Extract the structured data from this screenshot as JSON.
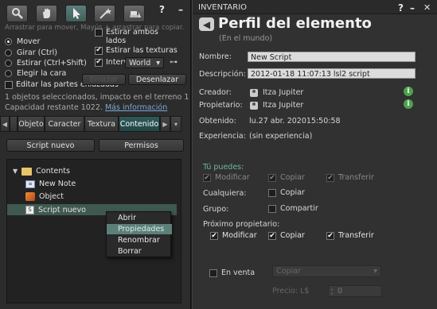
{
  "build": {
    "hint": "Arrastrar para mover, Mayús + arrastrar para copiar.",
    "modes": [
      {
        "label": "Mover",
        "selected": true
      },
      {
        "label": "Girar (Ctrl)",
        "selected": false
      },
      {
        "label": "Estirar (Ctrl+Shift)",
        "selected": false
      },
      {
        "label": "Elegir la cara",
        "selected": false
      }
    ],
    "stretch_both": "Estirar ambos lados",
    "stretch_textures": "Estirar las texturas",
    "snap_interval": "Interv",
    "grid_mode": "World",
    "edit_linked": "Editar las partes enlazadas",
    "link_button": "Enlazar",
    "unlink_button": "Desenlazar",
    "selection_info": "1 objetos seleccionados, impacto en el terreno 1",
    "capacity": "Capacidad restante 1022.",
    "more_info": "Más información",
    "tabs": [
      "Objeto",
      "Caracter",
      "Textura",
      "Contenido"
    ],
    "active_tab": "Contenido",
    "new_script_button": "Script nuevo",
    "permissions_button": "Permisos",
    "tree": {
      "folder": "Contents",
      "items": [
        "New Note",
        "Object",
        "Script nuevo"
      ]
    },
    "context_menu": [
      "Abrir",
      "Propiedades",
      "Renombrar",
      "Borrar"
    ],
    "context_highlight": "Propiedades"
  },
  "inventory": {
    "window_title": "INVENTARIO",
    "title": "Perfil del elemento",
    "subtitle": "(En el mundo)",
    "name_label": "Nombre:",
    "name_value": "New Script",
    "description_label": "Descripción:",
    "description_value": "2012-01-18 11:07:13 lsl2 script",
    "creator_label": "Creador:",
    "creator_value": "Itza Jupiter",
    "owner_label": "Propietario:",
    "owner_value": "Itza Jupiter",
    "acquired_label": "Obtenido:",
    "acquired_value": "lu.27 abr. 202015:50:58",
    "experience_label": "Experiencia:",
    "experience_value": "(sin experiencia)",
    "you_can_label": "Tú puedes:",
    "you_can": [
      {
        "label": "Modificar",
        "checked": true
      },
      {
        "label": "Copiar",
        "checked": true
      },
      {
        "label": "Transferir",
        "checked": true
      }
    ],
    "anyone_label": "Cualquiera:",
    "anyone_copy": "Copiar",
    "group_label": "Grupo:",
    "group_share": "Compartir",
    "next_owner_label": "Próximo propietario:",
    "next_owner": [
      {
        "label": "Modificar",
        "checked": true
      },
      {
        "label": "Copiar",
        "checked": true
      },
      {
        "label": "Transferir",
        "checked": true
      }
    ],
    "for_sale_label": "En venta",
    "sale_type": "Copiar",
    "price_label": "Precio: L$",
    "price_value": "0"
  },
  "colors": {
    "accent_teal": "#2f5a5a",
    "highlight": "#5b807a",
    "info_green": "#4ea24e",
    "you_can_green": "#6fb7a0"
  }
}
